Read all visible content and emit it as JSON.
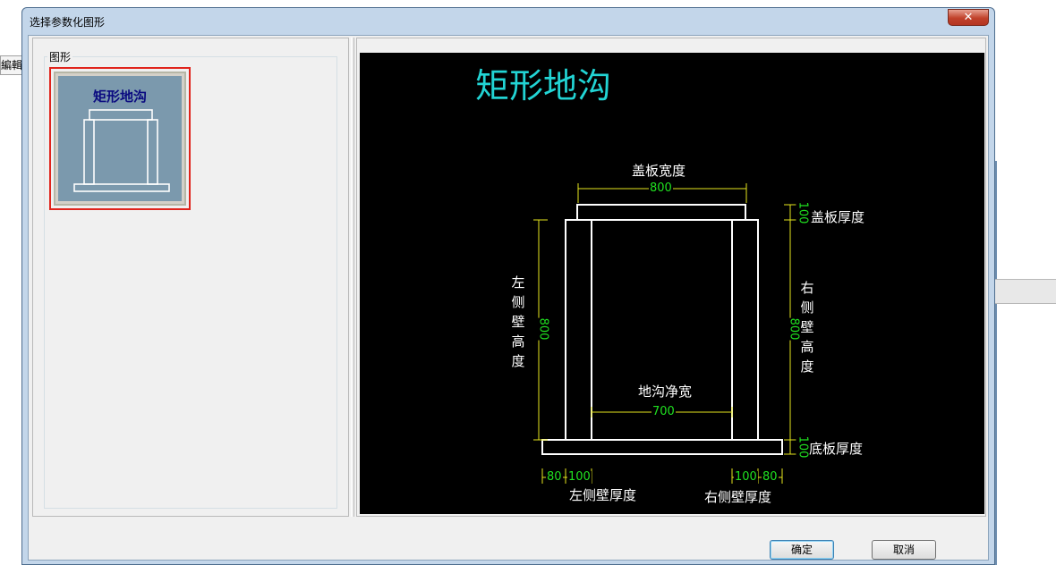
{
  "background": {
    "left_edit_text": "編輯器"
  },
  "dialog": {
    "title": "选择参数化图形",
    "close_glyph": "✕"
  },
  "left_pane": {
    "group_label": "图形",
    "thumbnails": [
      {
        "label": "矩形地沟",
        "selected": true
      }
    ],
    "selection_color": "#e0241c",
    "thumbnail_bg": "#7b99ad"
  },
  "preview": {
    "title": "矩形地沟",
    "title_color": "#22d4d4",
    "dimension_color": "#20e020",
    "labels": {
      "cover_width": "盖板宽度",
      "cover_thickness": "盖板厚度",
      "left_wall_height": [
        "左",
        "侧",
        "壁",
        "高",
        "度"
      ],
      "right_wall_height": [
        "右",
        "侧",
        "壁",
        "高",
        "度"
      ],
      "clear_width": "地沟净宽",
      "base_thickness": "底板厚度",
      "left_wall_thickness": "左侧壁厚度",
      "right_wall_thickness": "右侧壁厚度"
    },
    "dimensions": {
      "cover_width": "800",
      "cover_thickness": "100",
      "left_wall_height": "800",
      "right_wall_height": "800",
      "clear_width": "700",
      "base_thickness": "100",
      "left_overhang": "80",
      "left_wall_thickness": "100",
      "right_wall_thickness": "100",
      "right_overhang": "80"
    }
  },
  "buttons": {
    "ok": "确定",
    "cancel": "取消"
  }
}
